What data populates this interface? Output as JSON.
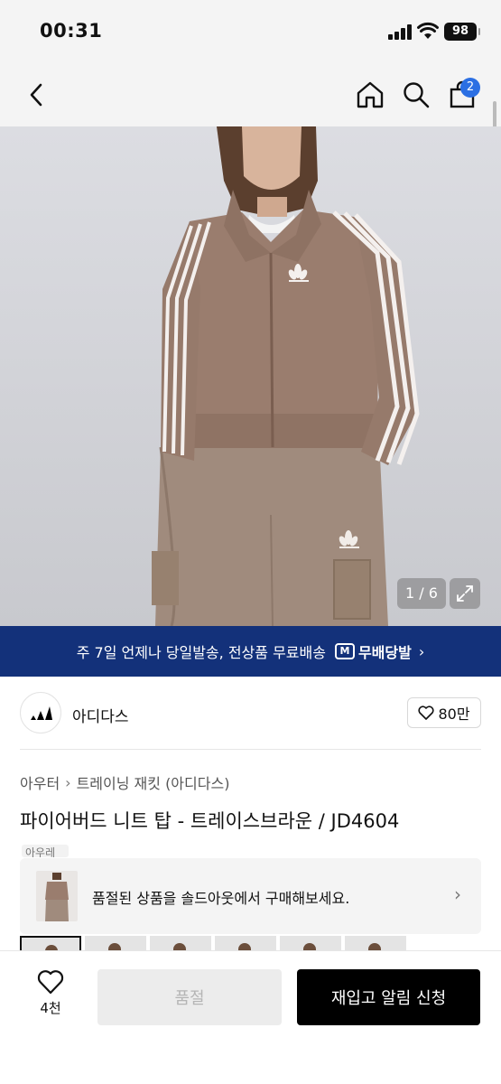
{
  "status_bar": {
    "time": "00:31",
    "battery": "98"
  },
  "nav": {
    "cart_count": "2"
  },
  "gallery": {
    "counter": "1 / 6"
  },
  "shipping_banner": {
    "text": "주 7일 언제나 당일발송, 전상품 무료배송",
    "logo_mark": "M",
    "logo_text": "무배당발",
    "chevron": "›"
  },
  "brand": {
    "name": "아디다스",
    "likes": "80만"
  },
  "breadcrumb": {
    "items": [
      "아우터",
      "트레이닝 재킷 (아디다스)"
    ],
    "separator": "›"
  },
  "product": {
    "title": "파이어버드 니트 탑 - 트레이스브라운 / JD4604",
    "tag": "아우레"
  },
  "soldout_notice": {
    "text": "품절된 상품을 솔드아웃에서 구매해보세요.",
    "chevron": "›"
  },
  "bottom_bar": {
    "wish_count": "4천",
    "soldout_label": "품절",
    "restock_label": "재입고 알림 신청"
  },
  "colors": {
    "banner_bg": "#13317a",
    "badge": "#2b6fe3",
    "jacket": "#9a7d6e",
    "primary_button": "#000000"
  }
}
